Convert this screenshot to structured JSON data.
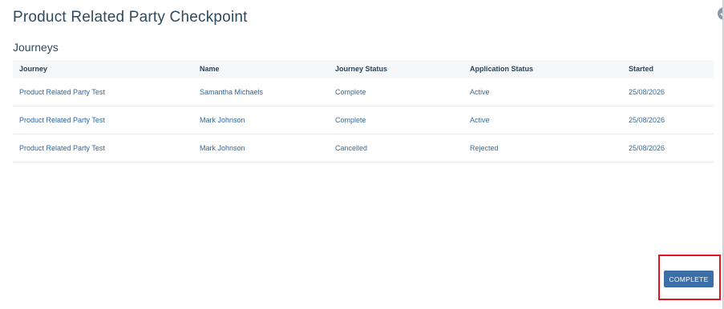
{
  "page": {
    "title": "Product Related Party Checkpoint",
    "section_title": "Journeys"
  },
  "table": {
    "columns": [
      "Journey",
      "Name",
      "Journey Status",
      "Application Status",
      "Started"
    ],
    "rows": [
      {
        "journey": "Product Related Party Test",
        "name": "Samantha Michaels",
        "journey_status": "Complete",
        "application_status": "Active",
        "started": "25/08/2026"
      },
      {
        "journey": "Product Related Party Test",
        "name": "Mark Johnson",
        "journey_status": "Complete",
        "application_status": "Active",
        "started": "25/08/2026"
      },
      {
        "journey": "Product Related Party Test",
        "name": "Mark Johnson",
        "journey_status": "Cancelled",
        "application_status": "Rejected",
        "started": "25/08/2026"
      }
    ]
  },
  "actions": {
    "complete_label": "COMPLETE"
  },
  "colors": {
    "accent": "#3c6ea7",
    "link": "#2d66a2",
    "highlight": "#e0141e",
    "header_bg": "#f6f7f9"
  },
  "icons": {
    "top_right": "check-circle-icon"
  }
}
